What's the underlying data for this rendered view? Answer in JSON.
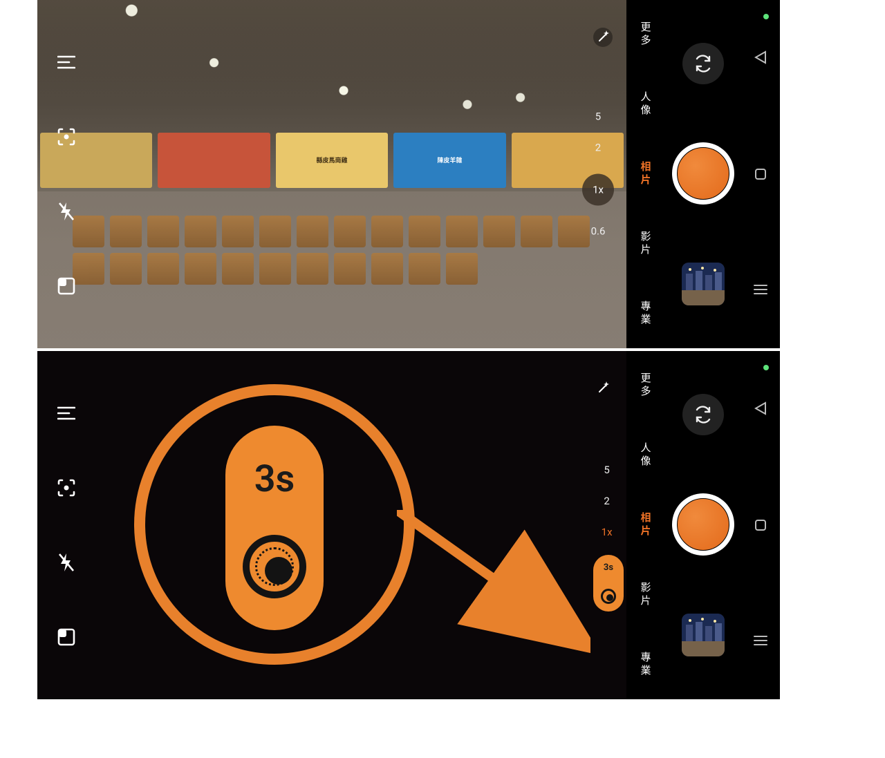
{
  "modes": {
    "more": "更多",
    "portrait": "人像",
    "photo": "相片",
    "video": "影片",
    "pro": "專業"
  },
  "zoom": {
    "levels": [
      "5",
      "2",
      "1x",
      "0.6"
    ],
    "selected": "1x"
  },
  "pill": {
    "label": "3s"
  },
  "small_pill": {
    "label": "3s"
  },
  "nav": {
    "back": "back",
    "home": "home",
    "tasks": "tasks"
  },
  "shops": [
    {
      "label": "",
      "bg": "#C9A85A"
    },
    {
      "label": "",
      "bg": "#C7543A"
    },
    {
      "label": "縣皮馬崗雞",
      "bg": "#E9C76B"
    },
    {
      "label": "陳皮羊雜",
      "bg": "#2C7FC1"
    },
    {
      "label": "",
      "bg": "#D9A84E"
    }
  ]
}
